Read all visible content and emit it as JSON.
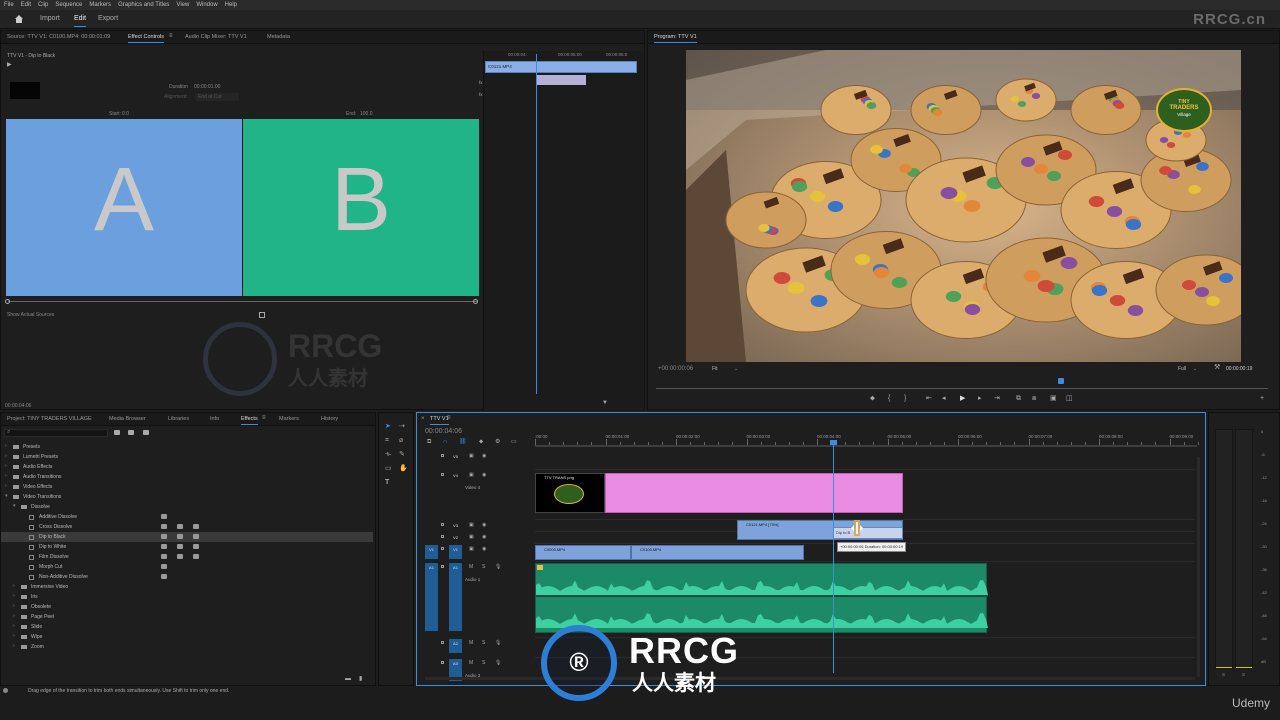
{
  "menu": [
    "File",
    "Edit",
    "Clip",
    "Sequence",
    "Markers",
    "Graphics and Titles",
    "View",
    "Window",
    "Help"
  ],
  "workspace": {
    "tabs": [
      "Import",
      "Edit",
      "Export"
    ],
    "active": "Edit"
  },
  "watermark_top": "RRCG.cn",
  "source_panel": {
    "tabs": [
      "Source: TTV V1: C0100.MP4: 00:00:01:09",
      "Effect Controls",
      "Audio Clip Mixer: TTV V1",
      "Metadata"
    ],
    "active": "Effect Controls",
    "clip_title": "TTV V1 - Dip to Black",
    "duration_label": "Duration",
    "duration_value": "00:00:01:00",
    "alignment_label": "Alignment:",
    "alignment_value": "End at Cut",
    "start_label": "Start:",
    "start_value": "0.0",
    "end_label": "End:",
    "end_value": "100.0",
    "preview_a": "A",
    "preview_b": "B",
    "show_actual_sources": "Show Actual Sources",
    "timecode": "00:00:04:06",
    "mini_timeline": {
      "times": [
        "00:00:04:",
        "00:00:05:00",
        "00:00:06:0"
      ],
      "clip": "C0121.MP4"
    }
  },
  "program_panel": {
    "title": "Program: TTV V1",
    "timecode_left": "+00:00:00:06",
    "fit": "Fit",
    "quality": "Full",
    "timecode_right": "00:00:00:19",
    "logo_text": [
      "TINY",
      "TRADERS",
      "Village"
    ]
  },
  "project_panel": {
    "tabs": [
      "Project: TINY TRADERS VILLAGE",
      "Media Browser",
      "Libraries",
      "Info",
      "Effects",
      "Markers",
      "History"
    ],
    "active": "Effects",
    "tree": [
      {
        "label": "Presets",
        "level": 0
      },
      {
        "label": "Lumetri Presets",
        "level": 0
      },
      {
        "label": "Audio Effects",
        "level": 0
      },
      {
        "label": "Audio Transitions",
        "level": 0
      },
      {
        "label": "Video Effects",
        "level": 0
      },
      {
        "label": "Video Transitions",
        "level": 0
      },
      {
        "label": "Dissolve",
        "level": 1
      },
      {
        "label": "Additive Dissolve",
        "level": 2
      },
      {
        "label": "Cross Dissolve",
        "level": 2
      },
      {
        "label": "Dip to Black",
        "level": 2,
        "selected": true
      },
      {
        "label": "Dip to White",
        "level": 2
      },
      {
        "label": "Film Dissolve",
        "level": 2
      },
      {
        "label": "Morph Cut",
        "level": 2
      },
      {
        "label": "Non-Additive Dissolve",
        "level": 2
      },
      {
        "label": "Immersive Video",
        "level": 1
      },
      {
        "label": "Iris",
        "level": 1
      },
      {
        "label": "Obsolete",
        "level": 1
      },
      {
        "label": "Page Peel",
        "level": 1
      },
      {
        "label": "Slide",
        "level": 1
      },
      {
        "label": "Wipe",
        "level": 1
      },
      {
        "label": "Zoom",
        "level": 1
      }
    ]
  },
  "timeline": {
    "tab": "TTV V1",
    "timecode": "00:00:04:06",
    "ruler": [
      ":00:00",
      "00:00:01:00",
      "00:00:02:00",
      "00:00:03:00",
      "00:00:04:00",
      "00:00:05:00",
      "00:00:06:00",
      "00:00:07:00",
      "00:00:08:00",
      "00:00:09:00"
    ],
    "tracks": [
      {
        "id": "V5",
        "name": ""
      },
      {
        "id": "V4",
        "name": "Video 4"
      },
      {
        "id": "V3",
        "name": ""
      },
      {
        "id": "V2",
        "name": ""
      },
      {
        "id": "V1",
        "name": ""
      },
      {
        "id": "A1",
        "name": "Audio 1"
      },
      {
        "id": "A2",
        "name": ""
      },
      {
        "id": "A3",
        "name": "Audio 3"
      }
    ],
    "clips": {
      "graphic": "TTV TRANS.png",
      "v2_clip": "C0121.MP4 [75%]",
      "v1_a": "C0000.MP4",
      "v1_b": "C0100.MP4",
      "transition": "Dip to B"
    },
    "tooltip": "+00:00:00:06  Duration: 00:00:00:19",
    "meter_scale": [
      "0",
      "-6",
      "-12",
      "-18",
      "-24",
      "-30",
      "-36",
      "-42",
      "-48",
      "-54",
      "dB"
    ],
    "meter_footer": [
      "S",
      "S"
    ]
  },
  "status": "Drag edge of the transition to trim both ends simultaneously. Use Shift to trim only one end.",
  "watermark_center": {
    "brand": "RRCG",
    "cn": "人人素材"
  },
  "brand_bottom": "Udemy"
}
